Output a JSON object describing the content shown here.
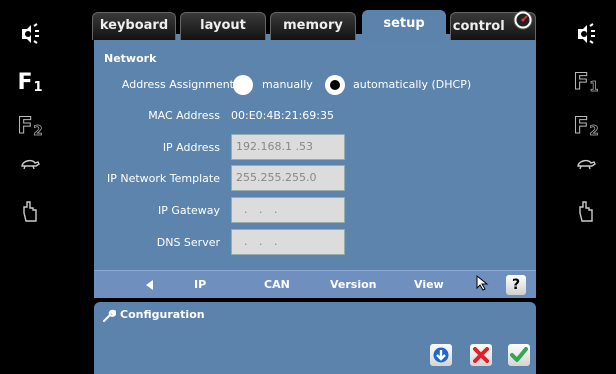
{
  "tabs": [
    {
      "label": "keyboard",
      "active": false
    },
    {
      "label": "layout",
      "active": false
    },
    {
      "label": "memory",
      "active": false
    },
    {
      "label": "setup",
      "active": true
    },
    {
      "label": "control",
      "active": false
    }
  ],
  "network": {
    "title": "Network",
    "address_assignment_label": "Address Assignment",
    "option_manual": "manually",
    "option_dhcp": "automatically (DHCP)",
    "selected_option": "automatically (DHCP)",
    "mac_label": "MAC Address",
    "mac_value": "00:E0:4B:21:69:35",
    "ip_label": "IP Address",
    "ip_value": "192.168.1 .53",
    "template_label": "IP Network Template",
    "template_value": "255.255.255.0",
    "gateway_label": "IP Gateway",
    "gateway_value": ". . .",
    "dns_label": "DNS Server",
    "dns_value": ". . ."
  },
  "subnav": {
    "items": [
      "IP",
      "CAN",
      "Version",
      "View"
    ],
    "active": "IP",
    "help": "?"
  },
  "configuration": {
    "title": "Configuration"
  },
  "left_rail": {
    "f1": "F",
    "f1_sub": "1",
    "f2": "F",
    "f2_sub": "2"
  },
  "right_rail": {
    "f1": "F",
    "f1_sub": "1",
    "f2": "F",
    "f2_sub": "2"
  },
  "colors": {
    "panel": "#5d84ad",
    "subnav": "#6f8fbf",
    "field": "#dcdcdc",
    "confirm": "#2fa84f",
    "cancel": "#e0202a",
    "download": "#1e66d0"
  }
}
